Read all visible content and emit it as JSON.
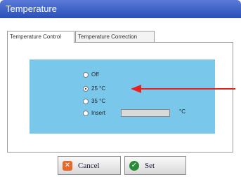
{
  "window": {
    "title": "Temperature"
  },
  "tabs": [
    {
      "label": "Temperature Control"
    },
    {
      "label": "Temperature Correction"
    }
  ],
  "temperature_options": [
    {
      "label": "Off",
      "checked": false
    },
    {
      "label": "25 °C",
      "checked": true
    },
    {
      "label": "35 °C",
      "checked": false
    },
    {
      "label": "Insert",
      "checked": false
    }
  ],
  "insert_field": {
    "value": "",
    "unit": "°C"
  },
  "buttons": {
    "cancel_label": "Cancel",
    "set_label": "Set"
  },
  "colors": {
    "title_bar": "#2a4fb8",
    "group_background": "#79c8ec",
    "annotation_arrow": "#e8201e"
  },
  "icons": {
    "cancel": "close-icon",
    "set": "check-icon"
  }
}
